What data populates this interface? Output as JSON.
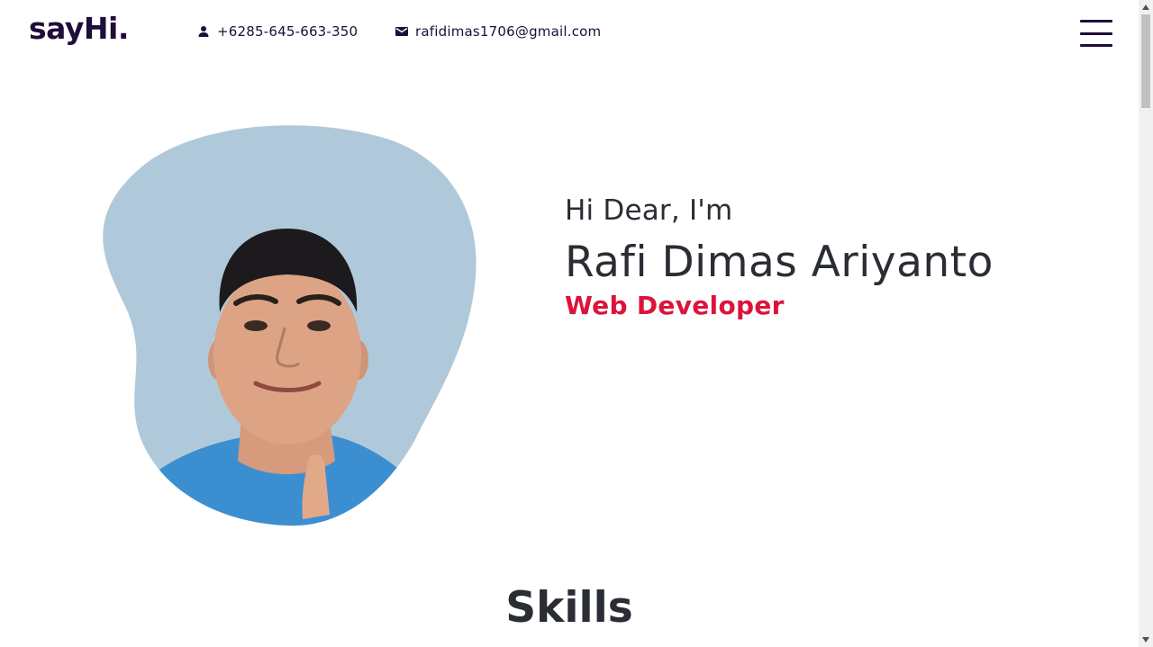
{
  "header": {
    "logo": "sayHi.",
    "phone": "+6285-645-663-350",
    "email": "rafidimas1706@gmail.com",
    "phone_icon": "person-icon",
    "email_icon": "mail-icon",
    "menu_icon": "hamburger-menu-icon"
  },
  "hero": {
    "greeting": "Hi Dear, I'm",
    "name": "Rafi Dimas Ariyanto",
    "role": "Web Developer"
  },
  "sections": {
    "skills_title": "Skills"
  },
  "colors": {
    "brand": "#1f0d3b",
    "accent": "#dc143c",
    "blob": "#b0c9da",
    "text": "#2a2d34"
  }
}
